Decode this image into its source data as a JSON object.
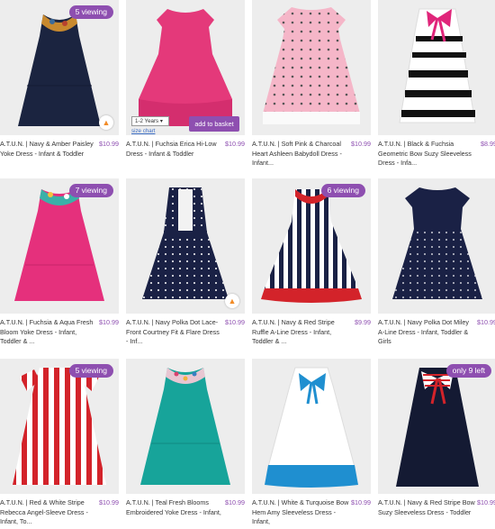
{
  "products": [
    {
      "name": "A.T.U.N. | Navy & Amber Paisley Yoke Dress - Infant & Toddler",
      "price": "$10.99",
      "badge": "5 viewing",
      "fire": true
    },
    {
      "name": "A.T.U.N. | Fuchsia Erica Hi-Low Dress - Infant & Toddler",
      "price": "$10.99",
      "badge": "",
      "fire": false,
      "hover": {
        "size": "1-2 Years",
        "size_chart": "size chart",
        "add_label": "add to basket"
      }
    },
    {
      "name": "A.T.U.N. | Soft Pink & Charcoal Heart Ashleen Babydoll Dress - Infant...",
      "price": "$10.99",
      "badge": "",
      "fire": false
    },
    {
      "name": "A.T.U.N. | Black & Fuchsia Geometric Bow Suzy Sleeveless Dress - Infa...",
      "price": "$8.99",
      "badge": "",
      "fire": false
    },
    {
      "name": "A.T.U.N. | Fuchsia & Aqua Fresh Bloom Yoke Dress - Infant, Toddler & ...",
      "price": "$10.99",
      "badge": "7 viewing",
      "fire": false
    },
    {
      "name": "A.T.U.N. | Navy Polka Dot Lace-Front Courtney Fit & Flare Dress - Inf...",
      "price": "$10.99",
      "badge": "",
      "fire": true
    },
    {
      "name": "A.T.U.N. | Navy & Red Stripe Ruffle A-Line Dress - Infant, Toddler & ...",
      "price": "$9.99",
      "badge": "6 viewing",
      "fire": false
    },
    {
      "name": "A.T.U.N. | Navy Polka Dot Miley A-Line Dress - Infant, Toddler & Girls",
      "price": "$10.99",
      "badge": "",
      "fire": false
    },
    {
      "name": "A.T.U.N. | Red & White Stripe Rebecca Angel-Sleeve Dress - Infant, To...",
      "price": "$10.99",
      "badge": "5 viewing",
      "fire": false
    },
    {
      "name": "A.T.U.N. | Teal Fresh Blooms Embroidered Yoke Dress - Infant,",
      "price": "$10.99",
      "badge": "",
      "fire": false
    },
    {
      "name": "A.T.U.N. | White & Turquoise Bow Hem Amy Sleeveless Dress - Infant,",
      "price": "$10.99",
      "badge": "",
      "fire": false
    },
    {
      "name": "A.T.U.N. | Navy & Red Stripe Bow Suzy Sleeveless Dress - Toddler",
      "price": "$10.99",
      "badge": "only 9 left",
      "fire": false
    }
  ],
  "colors": {
    "accent": "#8e4fb0",
    "link": "#3b6dc4"
  }
}
